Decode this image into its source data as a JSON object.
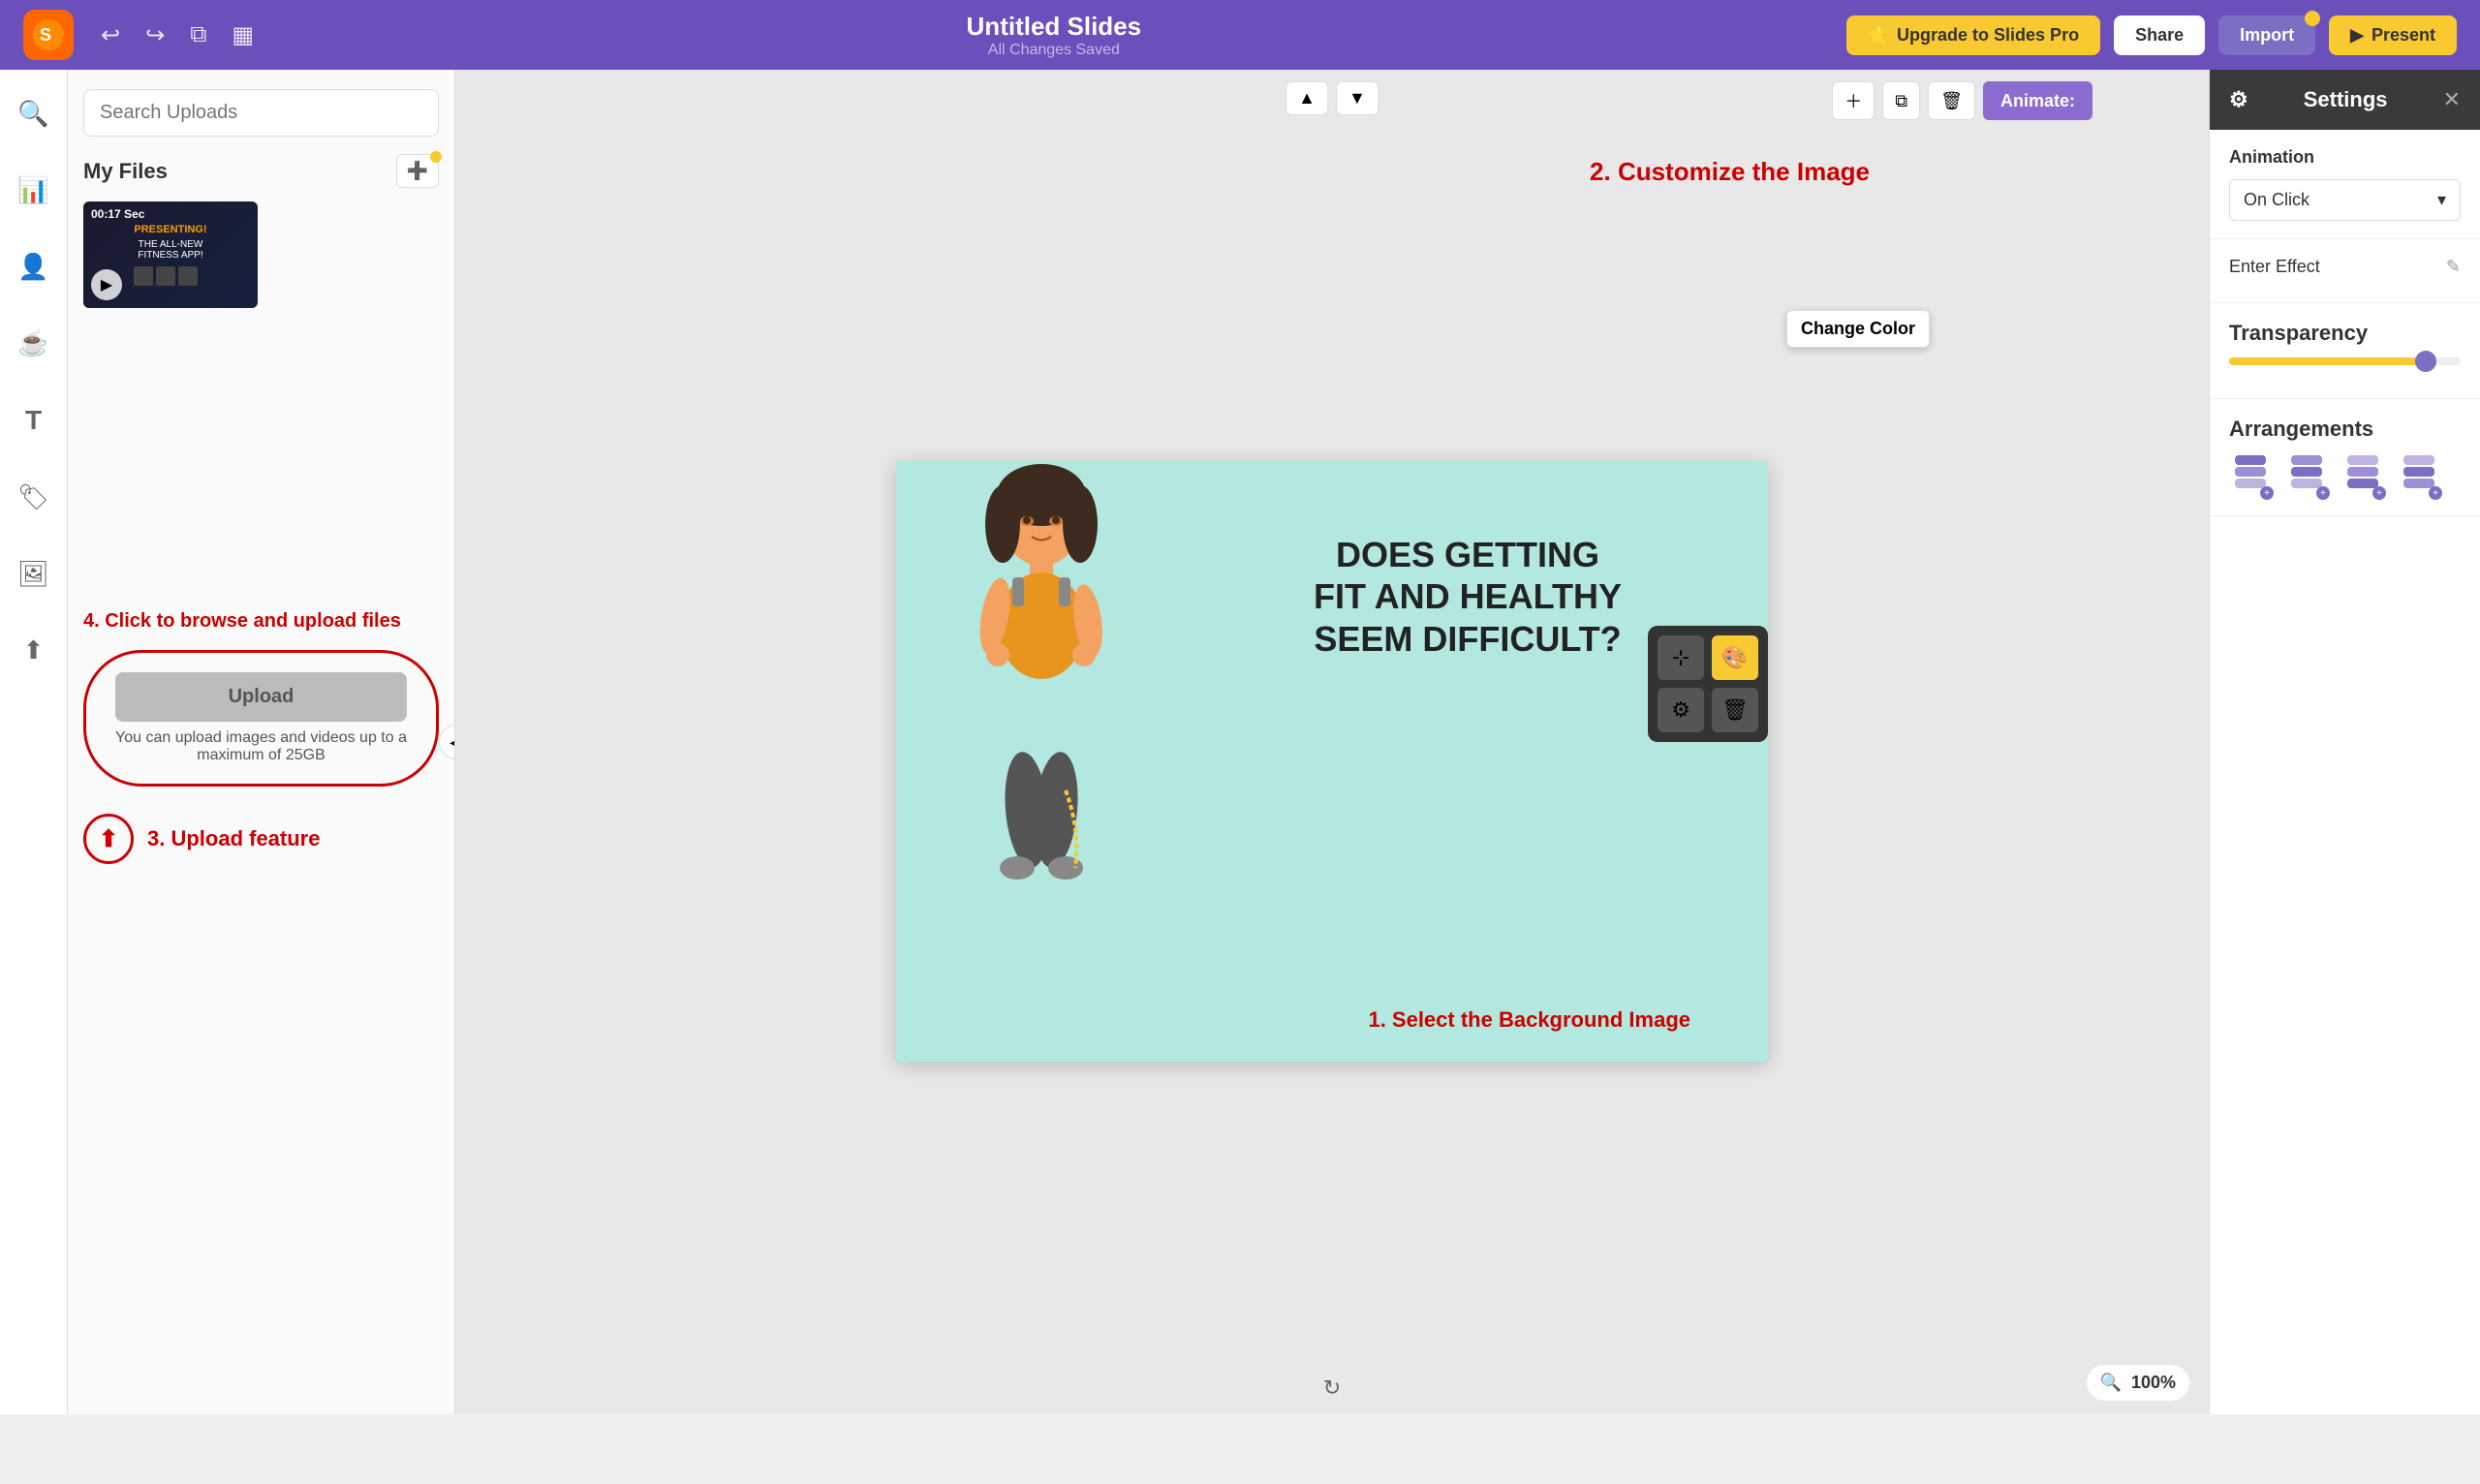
{
  "topbar": {
    "title": "Untitled Slides",
    "subtitle": "All Changes Saved",
    "upgrade_label": "Upgrade to Slides Pro",
    "share_label": "Share",
    "import_label": "Import",
    "present_label": "Present"
  },
  "left_panel": {
    "search_placeholder": "Search Uploads",
    "my_files_label": "My Files",
    "upload_hint": "4. Click to browse and upload files",
    "upload_btn_label": "Upload",
    "upload_subtext": "You can upload images and videos up to a maximum of 25GB",
    "upload_feature_label": "3. Upload feature",
    "thumbnail_time": "00:17 Sec",
    "thumbnail_tag": "PRESENTING!"
  },
  "canvas": {
    "animate_label": "Animate:",
    "zoom_label": "100%",
    "slide_text_line1": "DOES GETTING",
    "slide_text_line2": "FIT AND HEALTHY",
    "slide_text_line3": "SEEM DIFFICULT?",
    "annotation_customize": "2. Customize the Image",
    "annotation_select_bg": "1. Select the Background Image"
  },
  "popup": {
    "change_color_tooltip": "Change Color"
  },
  "settings": {
    "header_label": "Settings",
    "animation_label": "Animation",
    "on_click_label": "On Click",
    "enter_effect_label": "Enter Effect",
    "transparency_label": "Transparency",
    "transparency_value": 85,
    "arrangements_label": "Arrangements",
    "arrangements": [
      {
        "label": "bring-to-front",
        "dot": "+"
      },
      {
        "label": "bring-forward",
        "dot": "+"
      },
      {
        "label": "send-backward",
        "dot": "+"
      },
      {
        "label": "send-to-back",
        "dot": "+"
      }
    ]
  }
}
